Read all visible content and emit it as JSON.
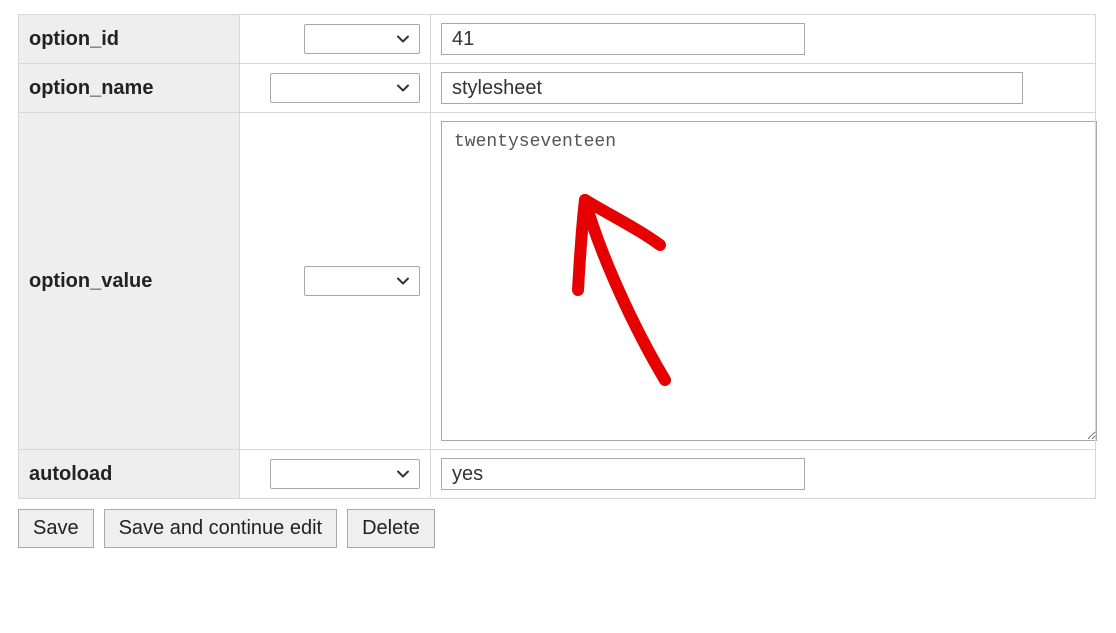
{
  "rows": {
    "option_id": {
      "label": "option_id",
      "value": "41"
    },
    "option_name": {
      "label": "option_name",
      "value": "stylesheet"
    },
    "option_value": {
      "label": "option_value",
      "value": "twentyseventeen"
    },
    "autoload": {
      "label": "autoload",
      "value": "yes"
    }
  },
  "buttons": {
    "save": "Save",
    "save_continue": "Save and continue edit",
    "delete": "Delete"
  }
}
